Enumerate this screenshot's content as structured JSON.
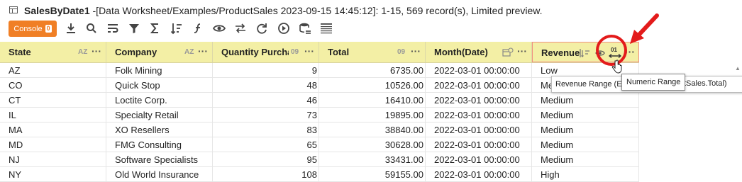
{
  "window": {
    "title_bold": "SalesByDate1",
    "title_rest": " -[Data Worksheet/Examples/ProductSales 2023-09-15 14:45:12]: 1-15, 569 record(s), Limited preview."
  },
  "toolbar": {
    "console_label": "Console",
    "console_badge": "0",
    "icons": [
      "download-icon",
      "search-icon",
      "wrap-icon",
      "filter-icon",
      "sum-icon",
      "sort-icon",
      "function-icon",
      "eye-icon",
      "swap-icon",
      "refresh-icon",
      "play-icon",
      "database-icon",
      "grid-icon"
    ]
  },
  "columns": [
    {
      "label": "State",
      "tag": "AZ"
    },
    {
      "label": "Company",
      "tag": "AZ"
    },
    {
      "label": "Quantity Purcha",
      "tag": "09"
    },
    {
      "label": "Total",
      "tag": "09"
    },
    {
      "label": "Month(Date)",
      "tag": ""
    },
    {
      "label": "Revenue",
      "tag": ""
    }
  ],
  "rows": [
    [
      "AZ",
      "Folk Mining",
      "9",
      "6735.00",
      "2022-03-01 00:00:00",
      "Low"
    ],
    [
      "CO",
      "Quick Stop",
      "48",
      "10526.00",
      "2022-03-01 00:00:00",
      "Me"
    ],
    [
      "CT",
      "Loctite Corp.",
      "46",
      "16410.00",
      "2022-03-01 00:00:00",
      "Medium"
    ],
    [
      "IL",
      "Specialty Retail",
      "73",
      "19895.00",
      "2022-03-01 00:00:00",
      "Medium"
    ],
    [
      "MA",
      "XO Resellers",
      "83",
      "38840.00",
      "2022-03-01 00:00:00",
      "Medium"
    ],
    [
      "MD",
      "FMG Consulting",
      "65",
      "30628.00",
      "2022-03-01 00:00:00",
      "Medium"
    ],
    [
      "NJ",
      "Software Specialists",
      "95",
      "33431.00",
      "2022-03-01 00:00:00",
      "Medium"
    ],
    [
      "NY",
      "Old World Insurance",
      "108",
      "59155.00",
      "2022-03-01 00:00:00",
      "High"
    ]
  ],
  "revenue_header_icons": [
    "sort-toggle-icon",
    "eye-icon",
    "numeric-range-icon"
  ],
  "tooltip_back": "Revenue Range (E",
  "tooltip_back_tail": "tSales.Total)",
  "tooltip_front": "Numeric Range",
  "colors": {
    "header_bg": "#f3efa5",
    "console_orange": "#f07f25",
    "annotation_red": "#e31b1b"
  }
}
